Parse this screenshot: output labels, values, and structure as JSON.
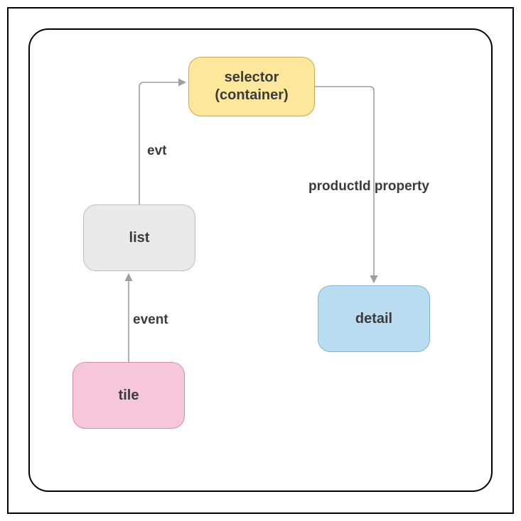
{
  "nodes": {
    "selector": {
      "label": "selector\n(container)",
      "color": "#fde79a"
    },
    "list": {
      "label": "list",
      "color": "#e9e9e9"
    },
    "tile": {
      "label": "tile",
      "color": "#f6c7d8"
    },
    "detail": {
      "label": "detail",
      "color": "#b9dcf0"
    }
  },
  "edges": {
    "tile_to_list": {
      "label": "event",
      "from": "tile",
      "to": "list"
    },
    "list_to_selector": {
      "label": "evt",
      "from": "list",
      "to": "selector"
    },
    "selector_to_detail": {
      "label": "productId property",
      "from": "selector",
      "to": "detail"
    }
  }
}
